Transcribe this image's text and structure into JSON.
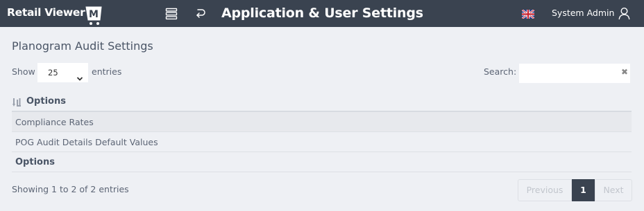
{
  "header": {
    "logo_text": "Retail Viewer",
    "logo_letter": "M",
    "title": "Application & User Settings",
    "user_name": "System Admin",
    "icons": {
      "menu": "list-icon",
      "back": "return-arrow-icon",
      "flag": "uk-flag-icon",
      "user": "user-icon"
    },
    "colors": {
      "bar": "#3a4350"
    }
  },
  "page": {
    "title": "Planogram Audit Settings"
  },
  "length_control": {
    "show_label": "Show",
    "selected": "25",
    "entries_label": "entries"
  },
  "search": {
    "label": "Search:",
    "value": "",
    "clear": "✖"
  },
  "table": {
    "header": "Options",
    "rows": [
      {
        "option": "Compliance Rates"
      },
      {
        "option": "POG Audit Details Default Values"
      }
    ],
    "footer": "Options"
  },
  "info": "Showing 1 to 2 of 2 entries",
  "pagination": {
    "previous": "Previous",
    "current": "1",
    "next": "Next",
    "active_color": "#3a4350"
  }
}
